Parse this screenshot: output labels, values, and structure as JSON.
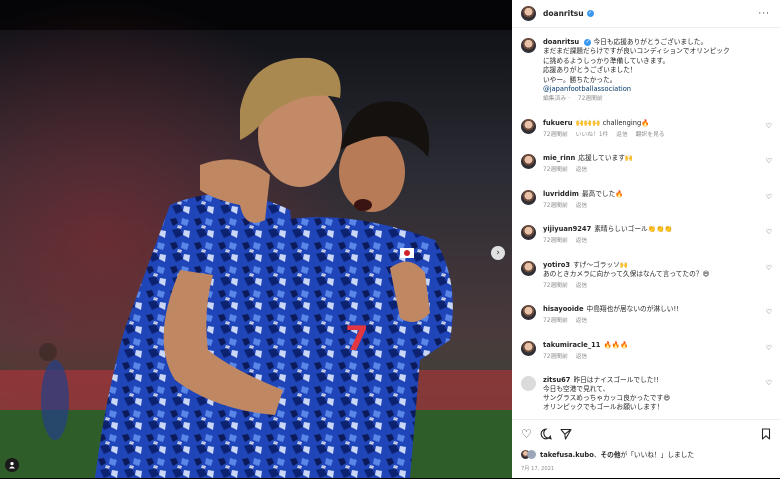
{
  "post": {
    "username": "doanritsu",
    "more_icon": "ellipsis-icon",
    "next_icon": "chevron-right-icon",
    "tag_icon": "user-tag-icon"
  },
  "caption": {
    "user": "doanritsu",
    "lines": [
      "今日も応援ありがとうございました。",
      "まだまだ課題だらけですが良いコンディションでオリンピック",
      "に挑めるようしっかり準備していきます。",
      "応援ありがとうございました！",
      "いやー。勝ちたかった。"
    ],
    "mention": "@japanfootballassociation",
    "edited": "編集済み",
    "time": "72週間前"
  },
  "comments": [
    {
      "user": "fukueru",
      "text": "🙌🙌🙌 challenging🔥",
      "time": "72週間前",
      "likes": "いいね！1件",
      "reply": "返信",
      "translate": "翻訳を見る"
    },
    {
      "user": "mie_rinn",
      "text": "応援しています🙌",
      "time": "72週間前",
      "reply": "返信"
    },
    {
      "user": "luvriddim",
      "text": "最高でした🔥",
      "time": "72週間前",
      "reply": "返信"
    },
    {
      "user": "yijiyuan9247",
      "text": "素晴らしいゴール👏👏👏",
      "time": "72週間前",
      "reply": "返信"
    },
    {
      "user": "yotiro3",
      "text": "すげ〜ゴラッソ🙌",
      "text2": "あのときカメラに向かって久保はなんて言ってたの？😄",
      "time": "72週間前",
      "reply": "返信"
    },
    {
      "user": "hisayooide",
      "text": "中島翔也が居ないのが淋しい!!",
      "time": "72週間前",
      "reply": "返信"
    },
    {
      "user": "takumiracle_11",
      "text": "🔥🔥🔥",
      "time": "72週間前",
      "reply": "返信"
    },
    {
      "user": "zitsu67",
      "text": "昨日はナイスゴールでした!!",
      "text2": "今日も空港で見れて、",
      "text3": "サングラスめっちゃカッコ良かったです😄",
      "text4": "オリンピックでもゴールお願いします！",
      "time": "",
      "reply": ""
    }
  ],
  "actions": {
    "heart_icon": "heart-icon",
    "comment_icon": "comment-icon",
    "share_icon": "share-icon",
    "bookmark_icon": "bookmark-icon"
  },
  "likes": {
    "user": "takefusa.kubo",
    "middle": "、",
    "others": "その他",
    "suffix": "が「いいね！」しました"
  },
  "date": "7月 17, 2021",
  "colors": {
    "verified": "#3897f0",
    "link": "#00376b",
    "muted": "#8e8e8e"
  }
}
